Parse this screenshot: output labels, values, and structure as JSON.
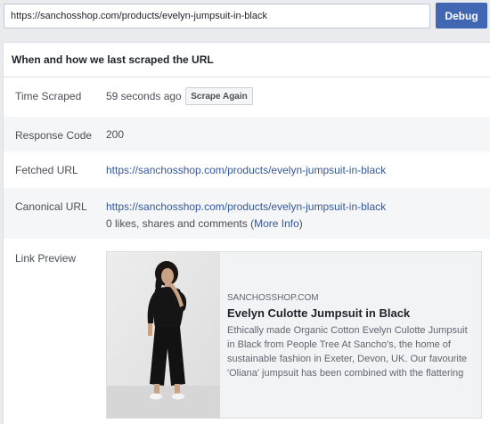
{
  "search": {
    "url_value": "https://sanchosshop.com/products/evelyn-jumpsuit-in-black",
    "debug_label": "Debug"
  },
  "panel": {
    "header": "When and how we last scraped the URL",
    "time_scraped": {
      "label": "Time Scraped",
      "value": "59 seconds ago",
      "button": "Scrape Again"
    },
    "response_code": {
      "label": "Response Code",
      "value": "200"
    },
    "fetched_url": {
      "label": "Fetched URL",
      "value": "https://sanchosshop.com/products/evelyn-jumpsuit-in-black"
    },
    "canonical_url": {
      "label": "Canonical URL",
      "value": "https://sanchosshop.com/products/evelyn-jumpsuit-in-black",
      "engagement_prefix": "0 likes, shares and comments (",
      "more_info": "More Info",
      "engagement_suffix": ")"
    },
    "link_preview": {
      "label": "Link Preview",
      "domain": "SANCHOSSHOP.COM",
      "title": "Evelyn Culotte Jumpsuit in Black",
      "description": "Ethically made Organic Cotton Evelyn Culotte Jumpsuit in Black from People Tree At Sancho's, the home of sustainable fashion in Exeter, Devon, UK. Our favourite 'Oliana' jumpsuit has been combined with the flattering"
    }
  },
  "colors": {
    "accent": "#4267b2",
    "link": "#365899",
    "page_bg": "#e9ebee"
  }
}
